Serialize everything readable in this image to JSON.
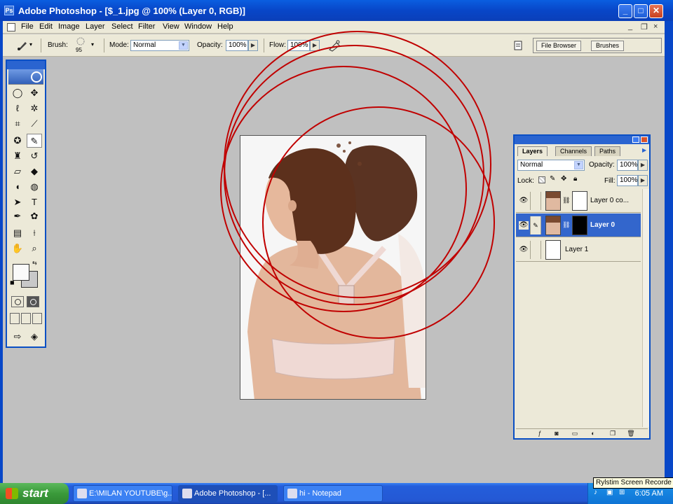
{
  "window": {
    "title": "Adobe Photoshop - [$_1.jpg @ 100% (Layer 0, RGB)]",
    "app_icon_letter": "Ps",
    "buttons": {
      "minimize": "_",
      "maximize": "□",
      "close": "✕"
    }
  },
  "menu": {
    "items": [
      "File",
      "Edit",
      "Image",
      "Layer",
      "Select",
      "Filter",
      "View",
      "Window",
      "Help"
    ],
    "doc_controls": {
      "minimize": "_",
      "restore": "❐",
      "close": "×"
    }
  },
  "options": {
    "brush_label": "Brush:",
    "brush_size": "95",
    "mode_label": "Mode:",
    "mode_value": "Normal",
    "opacity_label": "Opacity:",
    "opacity_value": "100%",
    "flow_label": "Flow:",
    "flow_value": "100%",
    "well_tabs": [
      "File Browser",
      "Brushes"
    ]
  },
  "layers_palette": {
    "tabs": [
      "Layers",
      "Channels",
      "Paths"
    ],
    "blend_mode": "Normal",
    "opacity_label": "Opacity:",
    "opacity_value": "100%",
    "lock_label": "Lock:",
    "fill_label": "Fill:",
    "fill_value": "100%",
    "layers": [
      {
        "name": "Layer 0 co...",
        "selected": false
      },
      {
        "name": "Layer 0",
        "selected": true
      },
      {
        "name": "Layer 1",
        "selected": false
      }
    ]
  },
  "taskbar": {
    "start_label": "start",
    "tasks": [
      "E:\\MILAN YOUTUBE\\g...",
      "Adobe Photoshop - [...",
      "hi - Notepad"
    ],
    "clock": "6:05 AM",
    "tooltip": "Rylstim Screen Recorde"
  },
  "colors": {
    "xp_blue": "#0a4fc4",
    "selection_blue": "#3366cc",
    "annotation_red": "#c00000",
    "start_green": "#3a9a3a"
  }
}
